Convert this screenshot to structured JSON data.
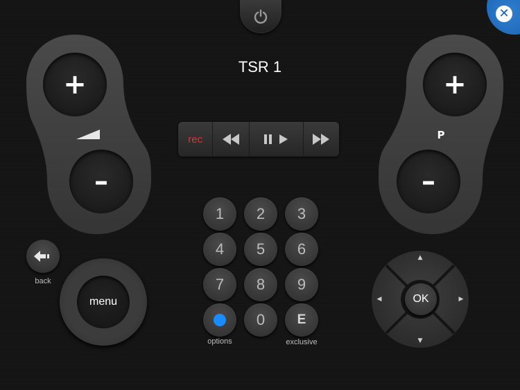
{
  "header": {
    "channel": "TSR 1"
  },
  "icons": {
    "power": "power-icon",
    "close": "close-icon",
    "back": "back-arrow-icon",
    "volume": "volume-wedge-icon"
  },
  "colors": {
    "accent_blue": "#1a8cff",
    "rec_red": "#e03434",
    "close_blue": "#1f6cc0"
  },
  "volume_rocker": {
    "plus": "+",
    "minus": "–"
  },
  "program_rocker": {
    "plus": "+",
    "minus": "–",
    "label": "P"
  },
  "transport": {
    "rec": "rec"
  },
  "keypad": {
    "keys": [
      "1",
      "2",
      "3",
      "4",
      "5",
      "6",
      "7",
      "8",
      "9"
    ],
    "zero": "0",
    "exclusive_key": "E",
    "options_label": "options",
    "exclusive_label": "exclusive"
  },
  "back": {
    "label": "back"
  },
  "menu": {
    "label": "menu"
  },
  "dpad": {
    "ok": "OK",
    "up": "▲",
    "down": "▼",
    "left": "◀",
    "right": "▶"
  }
}
